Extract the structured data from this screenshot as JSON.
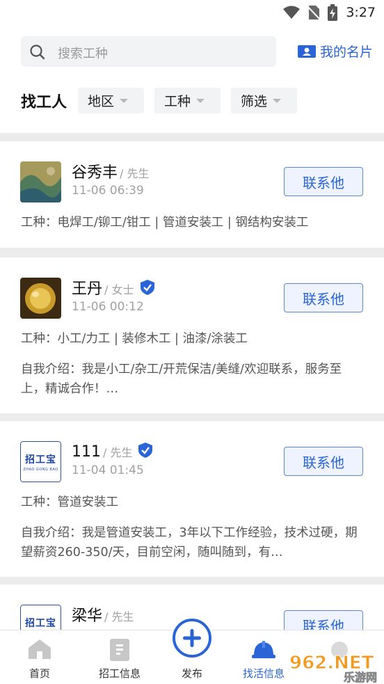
{
  "status": {
    "time": "3:27"
  },
  "search": {
    "placeholder": "搜索工种"
  },
  "my_card": {
    "label": "我的名片"
  },
  "filters": {
    "title": "找工人",
    "region": "地区",
    "trade": "工种",
    "screen": "筛选"
  },
  "workers": [
    {
      "name": "谷秀丰",
      "gender": "/ 先生",
      "time": "11-06 06:39",
      "verified": false,
      "trades": "工种：电焊工/铆工/钳工 | 管道安装工 | 钢结构安装工",
      "intro": "",
      "contact": "联系他"
    },
    {
      "name": "王丹",
      "gender": "/ 女士",
      "time": "11-06 00:12",
      "verified": true,
      "trades": "工种：小工/力工 | 装修木工 | 油漆/涂装工",
      "intro": "自我介绍：我是小工/杂工/开荒保洁/美缝/欢迎联系，服务至上，精诚合作！…",
      "contact": "联系他"
    },
    {
      "name": "111",
      "gender": "/ 先生",
      "time": "11-04 01:45",
      "verified": true,
      "trades": "工种：管道安装工",
      "intro": "自我介绍：我是管道安装工，3年以下工作经验，技术过硬，期望薪资260-350/天，目前空闲，随叫随到，有…",
      "contact": "联系他"
    },
    {
      "name": "梁华",
      "gender": "/ 先生",
      "time": "",
      "verified": false,
      "trades": "",
      "intro": "",
      "contact": "联系他"
    }
  ],
  "logo_text": {
    "main": "招工宝",
    "sub": "ZHAO GONG BAO"
  },
  "nav": {
    "home": "首页",
    "jobs": "招工信息",
    "publish": "发布",
    "find": "找活信息"
  },
  "watermark": {
    "main": "962.NET",
    "sub": "乐游网"
  },
  "colors": {
    "accent": "#2a64d6",
    "bg": "#ececec"
  }
}
